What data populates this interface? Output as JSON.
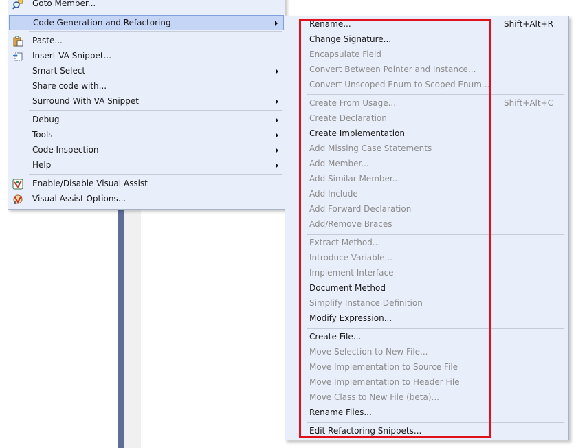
{
  "context_menu": {
    "items": [
      {
        "label": "Goto Member...",
        "icon": "goto-member-icon"
      },
      {
        "label": "Code Generation and Refactoring",
        "has_submenu": true,
        "highlighted": true
      },
      {
        "label": "Paste...",
        "icon": "paste-icon"
      },
      {
        "label": "Insert VA Snippet...",
        "icon": "insert-snippet-icon"
      },
      {
        "label": "Smart Select",
        "has_submenu": true
      },
      {
        "label": "Share code with..."
      },
      {
        "label": "Surround With VA Snippet",
        "has_submenu": true
      },
      {
        "label": "Debug",
        "has_submenu": true
      },
      {
        "label": "Tools",
        "has_submenu": true
      },
      {
        "label": "Code Inspection",
        "has_submenu": true
      },
      {
        "label": "Help",
        "has_submenu": true
      },
      {
        "label": "Enable/Disable Visual Assist",
        "icon": "visual-assist-toggle-icon"
      },
      {
        "label": "Visual Assist Options...",
        "icon": "visual-assist-options-icon"
      }
    ]
  },
  "submenu": {
    "items": [
      {
        "label": "Rename...",
        "shortcut": "Shift+Alt+R",
        "enabled": true
      },
      {
        "label": "Change Signature...",
        "enabled": true
      },
      {
        "label": "Encapsulate Field",
        "enabled": false
      },
      {
        "label": "Convert Between Pointer and Instance...",
        "enabled": false
      },
      {
        "label": "Convert Unscoped Enum to Scoped Enum...",
        "enabled": false
      },
      {
        "label": "Create From Usage...",
        "shortcut": "Shift+Alt+C",
        "enabled": false
      },
      {
        "label": "Create Declaration",
        "enabled": false
      },
      {
        "label": "Create Implementation",
        "enabled": true
      },
      {
        "label": "Add Missing Case Statements",
        "enabled": false
      },
      {
        "label": "Add Member...",
        "enabled": false
      },
      {
        "label": "Add Similar Member...",
        "enabled": false
      },
      {
        "label": "Add Include",
        "enabled": false
      },
      {
        "label": "Add Forward Declaration",
        "enabled": false
      },
      {
        "label": "Add/Remove Braces",
        "enabled": false
      },
      {
        "label": "Extract Method...",
        "enabled": false
      },
      {
        "label": "Introduce Variable...",
        "enabled": false
      },
      {
        "label": "Implement Interface",
        "enabled": false
      },
      {
        "label": "Document Method",
        "enabled": true
      },
      {
        "label": "Simplify Instance Definition",
        "enabled": false
      },
      {
        "label": "Modify Expression...",
        "enabled": true
      },
      {
        "label": "Create File...",
        "enabled": true
      },
      {
        "label": "Move Selection to New File...",
        "enabled": false
      },
      {
        "label": "Move Implementation to Source File",
        "enabled": false
      },
      {
        "label": "Move Implementation to Header File",
        "enabled": false
      },
      {
        "label": "Move Class to New File (beta)...",
        "enabled": false
      },
      {
        "label": "Rename Files...",
        "enabled": true
      },
      {
        "label": "Edit Refactoring Snippets...",
        "enabled": true
      }
    ]
  },
  "colors": {
    "menu_background": "#e9eefb",
    "highlight": "#c4d5f5",
    "disabled_text": "#8c8c8c",
    "annotation_box": "#e0101c"
  }
}
